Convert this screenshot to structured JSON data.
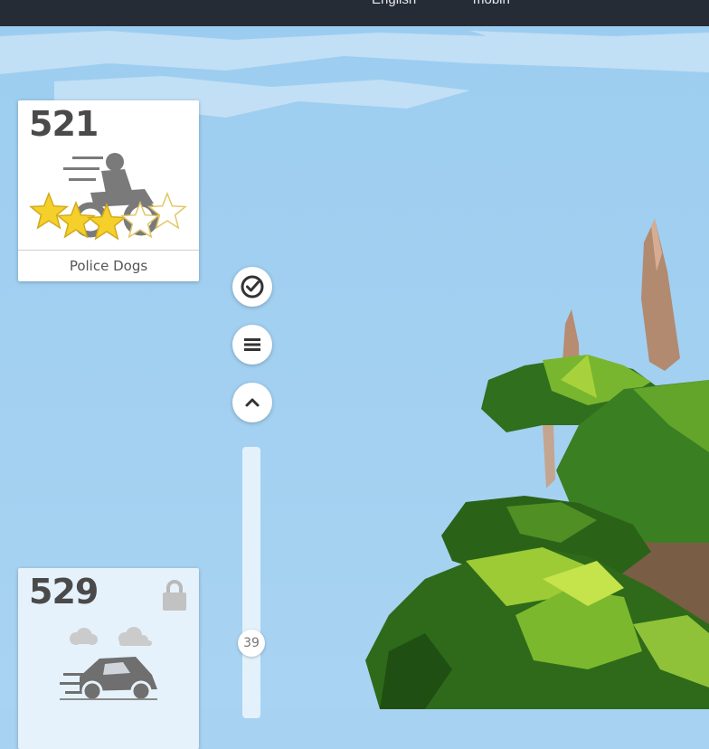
{
  "topbar": {
    "language_label": "English",
    "mode_label": "mobin"
  },
  "levels": [
    {
      "number": "521",
      "title": "Police Dogs",
      "stars_earned": 3,
      "stars_total": 5,
      "icon": "motorcycle-rider-icon",
      "locked": false
    },
    {
      "number": "529",
      "icon": "car-in-clouds-icon",
      "locked": true
    }
  ],
  "controls": {
    "check_icon": "check-circle-icon",
    "menu_icon": "hamburger-menu-icon",
    "up_icon": "chevron-up-icon"
  },
  "scroll": {
    "current_value": "39"
  },
  "colors": {
    "topbar": "#262c36",
    "sky": "#a8d2f2",
    "star_fill": "#f5d02a",
    "tree_dark": "#2d6d1c",
    "tree_light": "#a8d23b",
    "trunk": "#b38a73"
  }
}
